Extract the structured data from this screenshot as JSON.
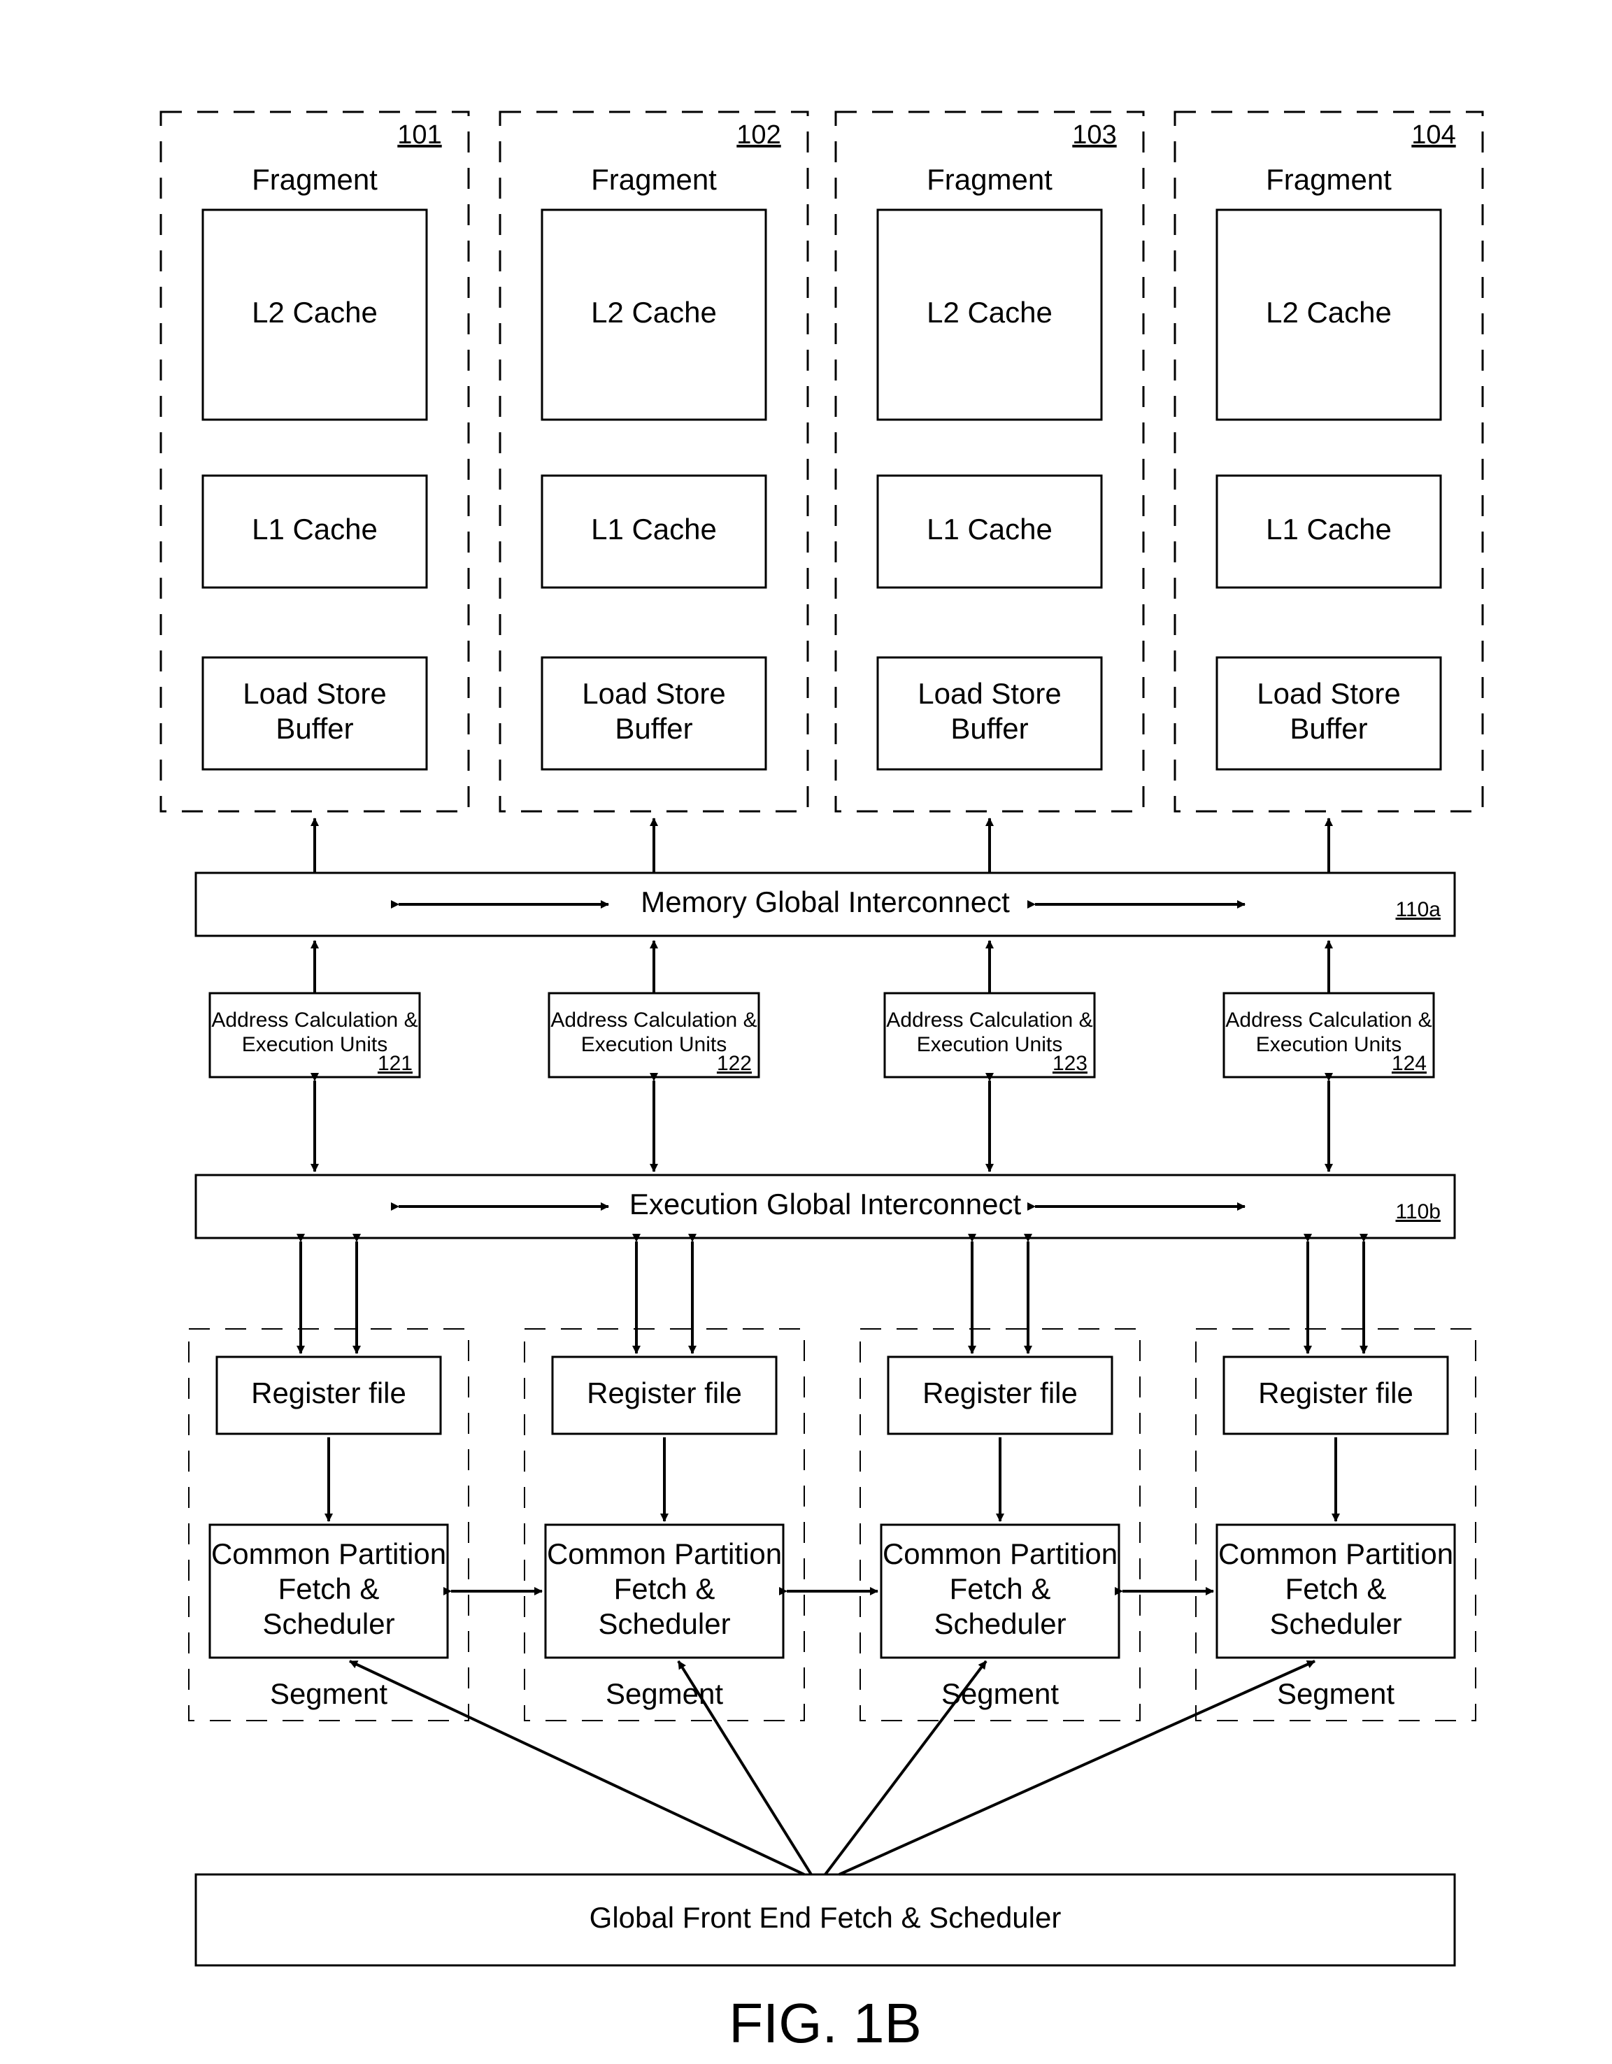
{
  "figure_label": "FIG. 1B",
  "fragments": [
    {
      "ref": "101",
      "title": "Fragment",
      "l2": "L2 Cache",
      "l1": "L1 Cache",
      "lsb": "Load Store Buffer"
    },
    {
      "ref": "102",
      "title": "Fragment",
      "l2": "L2 Cache",
      "l1": "L1 Cache",
      "lsb": "Load Store Buffer"
    },
    {
      "ref": "103",
      "title": "Fragment",
      "l2": "L2 Cache",
      "l1": "L1 Cache",
      "lsb": "Load Store Buffer"
    },
    {
      "ref": "104",
      "title": "Fragment",
      "l2": "L2 Cache",
      "l1": "L1 Cache",
      "lsb": "Load Store Buffer"
    }
  ],
  "mem_interconnect": {
    "label": "Memory Global Interconnect",
    "ref": "110a"
  },
  "exec_interconnect": {
    "label": "Execution Global Interconnect",
    "ref": "110b"
  },
  "exec_units": [
    {
      "line1": "Address Calculation &",
      "line2": "Execution Units",
      "ref": "121"
    },
    {
      "line1": "Address Calculation &",
      "line2": "Execution Units",
      "ref": "122"
    },
    {
      "line1": "Address Calculation &",
      "line2": "Execution Units",
      "ref": "123"
    },
    {
      "line1": "Address Calculation &",
      "line2": "Execution Units",
      "ref": "124"
    }
  ],
  "segments": [
    {
      "reg": "Register file",
      "cp1": "Common Partition",
      "cp2": "Fetch &",
      "cp3": "Scheduler",
      "seg": "Segment"
    },
    {
      "reg": "Register file",
      "cp1": "Common Partition",
      "cp2": "Fetch &",
      "cp3": "Scheduler",
      "seg": "Segment"
    },
    {
      "reg": "Register file",
      "cp1": "Common Partition",
      "cp2": "Fetch &",
      "cp3": "Scheduler",
      "seg": "Segment"
    },
    {
      "reg": "Register file",
      "cp1": "Common Partition",
      "cp2": "Fetch &",
      "cp3": "Scheduler",
      "seg": "Segment"
    }
  ],
  "global_front_end": "Global Front End Fetch & Scheduler"
}
